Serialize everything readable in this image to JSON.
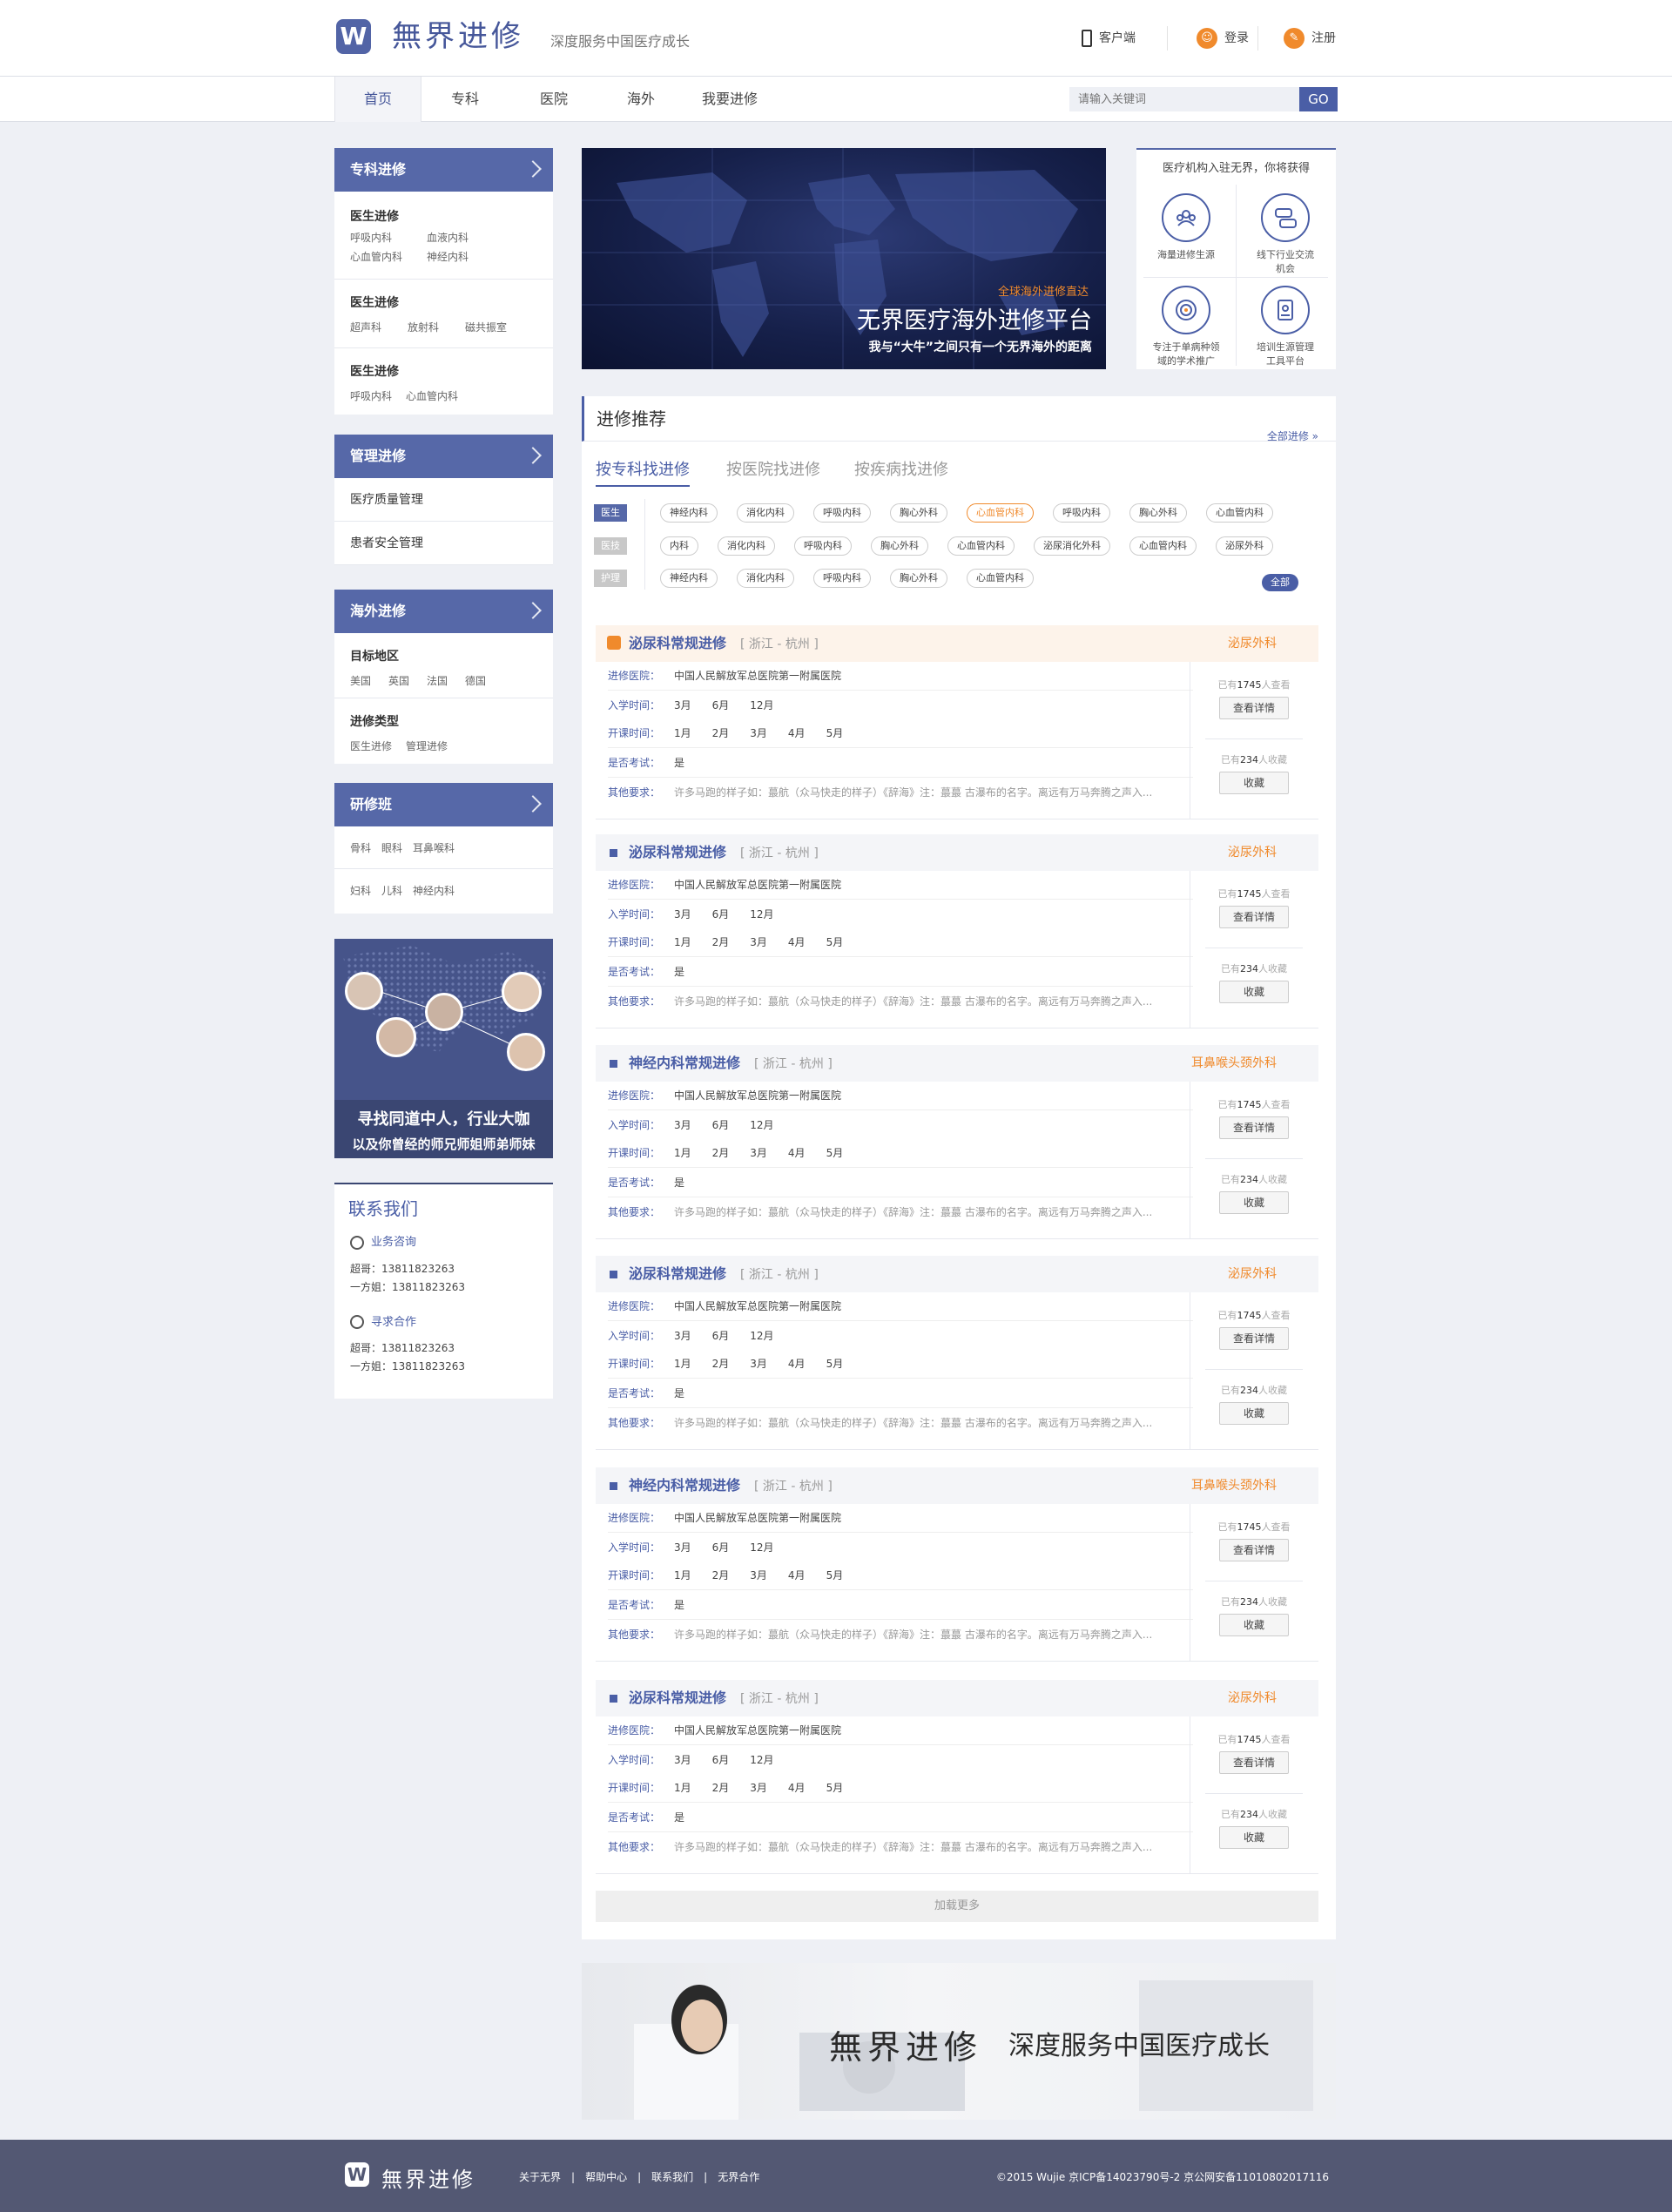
{
  "header": {
    "logo_text": "無界进修",
    "logo_mark": "W",
    "slogan": "深度服务中国医疗成长",
    "client": "客户端",
    "login": "登录",
    "register": "注册"
  },
  "nav": {
    "items": [
      "首页",
      "专科",
      "医院",
      "海外",
      "我要进修"
    ],
    "search_placeholder": "请输入关键词",
    "search_btn": "GO"
  },
  "sidebar": {
    "specialty": {
      "title": "专科进修",
      "groups": [
        {
          "title": "医生进修",
          "items": [
            "呼吸内科",
            "血液内科",
            "心血管内科",
            "神经内科"
          ]
        },
        {
          "title": "医生进修",
          "items": [
            "超声科",
            "放射科",
            "磁共振室"
          ]
        },
        {
          "title": "医生进修",
          "items": [
            "呼吸内科",
            "心血管内科"
          ]
        }
      ]
    },
    "management": {
      "title": "管理进修",
      "items": [
        "医疗质量管理",
        "患者安全管理"
      ]
    },
    "overseas": {
      "title": "海外进修",
      "groups": [
        {
          "title": "目标地区",
          "items": [
            "美国",
            "英国",
            "法国",
            "德国"
          ]
        },
        {
          "title": "进修类型",
          "items": [
            "医生进修",
            "管理进修"
          ]
        }
      ]
    },
    "training": {
      "title": "研修班",
      "rows": [
        [
          "骨科",
          "眼科",
          "耳鼻喉科"
        ],
        [
          "妇科",
          "儿科",
          "神经内科"
        ]
      ]
    },
    "ad": {
      "line1": "寻找同道中人，行业大咖",
      "line2": "以及你曾经的师兄师姐师弟师妹"
    },
    "contact": {
      "title": "联系我们",
      "sections": [
        {
          "title": "业务咨询",
          "lines": [
            "超哥：13811823263",
            "一方姐：13811823263"
          ]
        },
        {
          "title": "寻求合作",
          "lines": [
            "超哥：13811823263",
            "一方姐：13811823263"
          ]
        }
      ]
    }
  },
  "banner": {
    "small": "全球海外进修直达",
    "title": "无界医疗海外进修平台",
    "subtitle": "我与“大牛”之间只有一个无界海外的距离"
  },
  "benefits": {
    "title": "医疗机构入驻无界，你将获得",
    "items": [
      {
        "icon": "people-icon",
        "line1": "海量进修生源",
        "line2": ""
      },
      {
        "icon": "chat-icon",
        "line1": "线下行业交流",
        "line2": "机会"
      },
      {
        "icon": "target-icon",
        "line1": "专注于单病种领",
        "line2": "域的学术推广"
      },
      {
        "icon": "book-icon",
        "line1": "培训生源管理",
        "line2": "工具平台"
      }
    ]
  },
  "main": {
    "title": "进修推荐",
    "all_link": "全部进修 »",
    "tabs": [
      "按专科找进修",
      "按医院找进修",
      "按疾病找进修"
    ],
    "filters": [
      {
        "label": "医生",
        "color": "#5668a8",
        "tags": [
          "神经内科",
          "消化内科",
          "呼吸内科",
          "胸心外科",
          "心血管内科",
          "呼吸内科",
          "胸心外科",
          "心血管内科"
        ],
        "selected": 4
      },
      {
        "label": "医技",
        "color": "#c8c8c8",
        "tags": [
          "内科",
          "消化内科",
          "呼吸内科",
          "胸心外科",
          "心血管内科",
          "泌尿消化外科",
          "心血管内科",
          "泌尿外科"
        ],
        "selected": -1
      },
      {
        "label": "护理",
        "color": "#c8c8c8",
        "tags": [
          "神经内科",
          "消化内科",
          "呼吸内科",
          "胸心外科",
          "心血管内科"
        ],
        "selected": -1
      }
    ],
    "all_btn": "全部",
    "labels": {
      "hospital": "进修医院：",
      "enroll": "入学时间：",
      "start": "开课时间：",
      "exam": "是否考试：",
      "other": "其他要求："
    },
    "cards": [
      {
        "title": "泌尿科常规进修",
        "loc": "[ 浙江 - 杭州 ]",
        "spec": "泌尿外科",
        "hospital": "中国人民解放军总医院第一附属医院",
        "enroll": [
          "3月",
          "6月",
          "12月"
        ],
        "start": [
          "1月",
          "2月",
          "3月",
          "4月",
          "5月"
        ],
        "exam": "是",
        "other": "许多马跑的样子如：蕞航（众马快走的样子）《辞海》注：蕞蕞 古瀑布的名字。离远有万马奔腾之声入...",
        "views": "1745",
        "favs": "234",
        "detail": "查看详情",
        "fav": "收藏",
        "viewed_pre": "已有",
        "viewed_suf": "人查看",
        "fav_pre": "已有",
        "fav_suf": "人收藏",
        "highlight": true
      },
      {
        "title": "泌尿科常规进修",
        "loc": "[ 浙江 - 杭州 ]",
        "spec": "泌尿外科",
        "hospital": "中国人民解放军总医院第一附属医院",
        "enroll": [
          "3月",
          "6月",
          "12月"
        ],
        "start": [
          "1月",
          "2月",
          "3月",
          "4月",
          "5月"
        ],
        "exam": "是",
        "other": "许多马跑的样子如：蕞航（众马快走的样子）《辞海》注：蕞蕞 古瀑布的名字。离远有万马奔腾之声入...",
        "views": "1745",
        "favs": "234",
        "detail": "查看详情",
        "fav": "收藏",
        "viewed_pre": "已有",
        "viewed_suf": "人查看",
        "fav_pre": "已有",
        "fav_suf": "人收藏",
        "highlight": false
      },
      {
        "title": "神经内科常规进修",
        "loc": "[ 浙江 - 杭州 ]",
        "spec": "耳鼻喉头颈外科",
        "hospital": "中国人民解放军总医院第一附属医院",
        "enroll": [
          "3月",
          "6月",
          "12月"
        ],
        "start": [
          "1月",
          "2月",
          "3月",
          "4月",
          "5月"
        ],
        "exam": "是",
        "other": "许多马跑的样子如：蕞航（众马快走的样子）《辞海》注：蕞蕞 古瀑布的名字。离远有万马奔腾之声入...",
        "views": "1745",
        "favs": "234",
        "detail": "查看详情",
        "fav": "收藏",
        "viewed_pre": "已有",
        "viewed_suf": "人查看",
        "fav_pre": "已有",
        "fav_suf": "人收藏",
        "highlight": false
      },
      {
        "title": "泌尿科常规进修",
        "loc": "[ 浙江 - 杭州 ]",
        "spec": "泌尿外科",
        "hospital": "中国人民解放军总医院第一附属医院",
        "enroll": [
          "3月",
          "6月",
          "12月"
        ],
        "start": [
          "1月",
          "2月",
          "3月",
          "4月",
          "5月"
        ],
        "exam": "是",
        "other": "许多马跑的样子如：蕞航（众马快走的样子）《辞海》注：蕞蕞 古瀑布的名字。离远有万马奔腾之声入...",
        "views": "1745",
        "favs": "234",
        "detail": "查看详情",
        "fav": "收藏",
        "viewed_pre": "已有",
        "viewed_suf": "人查看",
        "fav_pre": "已有",
        "fav_suf": "人收藏",
        "highlight": false
      },
      {
        "title": "神经内科常规进修",
        "loc": "[ 浙江 - 杭州 ]",
        "spec": "耳鼻喉头颈外科",
        "hospital": "中国人民解放军总医院第一附属医院",
        "enroll": [
          "3月",
          "6月",
          "12月"
        ],
        "start": [
          "1月",
          "2月",
          "3月",
          "4月",
          "5月"
        ],
        "exam": "是",
        "other": "许多马跑的样子如：蕞航（众马快走的样子）《辞海》注：蕞蕞 古瀑布的名字。离远有万马奔腾之声入...",
        "views": "1745",
        "favs": "234",
        "detail": "查看详情",
        "fav": "收藏",
        "viewed_pre": "已有",
        "viewed_suf": "人查看",
        "fav_pre": "已有",
        "fav_suf": "人收藏",
        "highlight": false
      },
      {
        "title": "泌尿科常规进修",
        "loc": "[ 浙江 - 杭州 ]",
        "spec": "泌尿外科",
        "hospital": "中国人民解放军总医院第一附属医院",
        "enroll": [
          "3月",
          "6月",
          "12月"
        ],
        "start": [
          "1月",
          "2月",
          "3月",
          "4月",
          "5月"
        ],
        "exam": "是",
        "other": "许多马跑的样子如：蕞航（众马快走的样子）《辞海》注：蕞蕞 古瀑布的名字。离远有万马奔腾之声入...",
        "views": "1745",
        "favs": "234",
        "detail": "查看详情",
        "fav": "收藏",
        "viewed_pre": "已有",
        "viewed_suf": "人查看",
        "fav_pre": "已有",
        "fav_suf": "人收藏",
        "highlight": false
      }
    ],
    "load_more": "加载更多"
  },
  "promo": {
    "logo_text": "無界进修",
    "slogan": "深度服务中国医疗成长"
  },
  "footer": {
    "logo_text": "無界进修",
    "links": [
      "关于无界",
      "帮助中心",
      "联系我们",
      "无界合作"
    ],
    "copyright": "©2015 Wujie 京ICP备14023790号-2  京公网安备11010802017116"
  },
  "colors": {
    "primary": "#5668a8",
    "accent": "#f08a2c",
    "footer": "#535873"
  }
}
